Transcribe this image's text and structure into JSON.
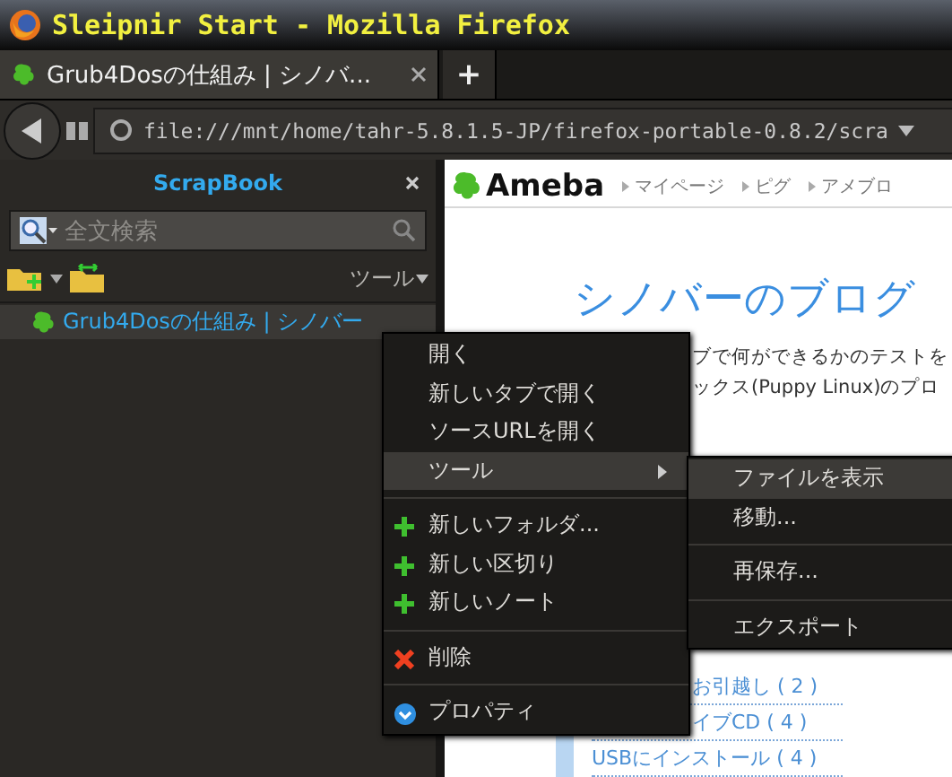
{
  "window": {
    "title": "Sleipnir Start - Mozilla Firefox"
  },
  "tabs": [
    {
      "label": "Grub4Dosの仕組み | シノバ...",
      "selected": true
    }
  ],
  "new_tab_button": "+",
  "address_bar": {
    "url": "file:///mnt/home/tahr-5.8.1.5-JP/firefox-portable-0.8.2/scra"
  },
  "sidebar": {
    "title": "ScrapBook",
    "search": {
      "placeholder": "全文検索"
    },
    "tools_menu": "ツール",
    "items": [
      {
        "label": "Grub4Dosの仕組み | シノバー",
        "selected": true
      }
    ]
  },
  "page": {
    "logo": "Ameba",
    "header_links": [
      "マイページ",
      "ピグ",
      "アメブロ"
    ],
    "blog_title": "シノバーのブログ",
    "description_lines": [
      "ブで何ができるかのテストを",
      "ックス(Puppy Linux)のプロ"
    ],
    "categories": [
      {
        "label": "お引越し ( 2 )",
        "clipped": true
      },
      {
        "label": "イブCD ( 4 )",
        "clipped": true
      },
      {
        "label": "USBにインストール ( 4 )",
        "clipped": false
      }
    ]
  },
  "context_menu": {
    "items": [
      {
        "kind": "plain",
        "label": "開く",
        "selected": false
      },
      {
        "kind": "plain",
        "label": "新しいタブで開く",
        "selected": false
      },
      {
        "kind": "plain",
        "label": "ソースURLを開く",
        "selected": false
      },
      {
        "kind": "submenu",
        "label": "ツール",
        "selected": true
      },
      {
        "kind": "separator"
      },
      {
        "kind": "add",
        "label": "新しいフォルダ...",
        "selected": false
      },
      {
        "kind": "add",
        "label": "新しい区切り",
        "selected": false
      },
      {
        "kind": "add",
        "label": "新しいノート",
        "selected": false
      },
      {
        "kind": "separator"
      },
      {
        "kind": "delete",
        "label": "削除",
        "selected": false
      },
      {
        "kind": "separator"
      },
      {
        "kind": "properties",
        "label": "プロパティ",
        "selected": false
      }
    ]
  },
  "submenu": {
    "items": [
      {
        "kind": "plain",
        "label": "ファイルを表示",
        "selected": true
      },
      {
        "kind": "plain",
        "label": "移動...",
        "selected": false
      },
      {
        "kind": "separator"
      },
      {
        "kind": "plain",
        "label": "再保存...",
        "selected": false
      },
      {
        "kind": "separator"
      },
      {
        "kind": "plain",
        "label": "エクスポート",
        "selected": false
      }
    ]
  }
}
